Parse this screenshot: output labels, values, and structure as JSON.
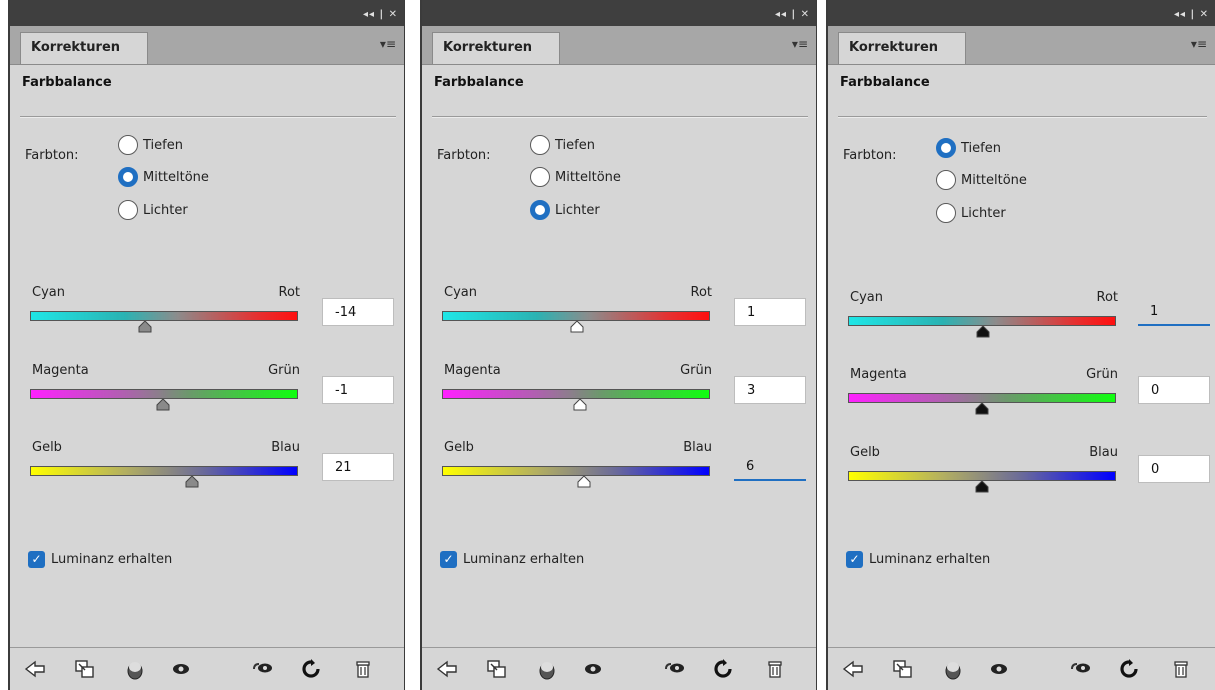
{
  "window": {
    "controls": "◂◂ | ✕"
  },
  "panels": [
    {
      "tab_label": "Korrekturen",
      "menu_icon": "▾≡",
      "title": "Farbbalance",
      "tone_label": "Farbton:",
      "tones": [
        {
          "label": "Tiefen",
          "checked": false
        },
        {
          "label": "Mitteltöne",
          "checked": true
        },
        {
          "label": "Lichter",
          "checked": false
        }
      ],
      "sliders": [
        {
          "left": "Cyan",
          "right": "Rot",
          "value": "-14",
          "min": -100,
          "max": 100,
          "thumb_color": "gray"
        },
        {
          "left": "Magenta",
          "right": "Grün",
          "value": "-1",
          "min": -100,
          "max": 100,
          "thumb_color": "gray"
        },
        {
          "left": "Gelb",
          "right": "Blau",
          "value": "21",
          "min": -100,
          "max": 100,
          "thumb_color": "gray"
        }
      ],
      "luminance_label": "Luminanz erhalten",
      "luminance_checked": true
    },
    {
      "tab_label": "Korrekturen",
      "menu_icon": "▾≡",
      "title": "Farbbalance",
      "tone_label": "Farbton:",
      "tones": [
        {
          "label": "Tiefen",
          "checked": false
        },
        {
          "label": "Mitteltöne",
          "checked": false
        },
        {
          "label": "Lichter",
          "checked": true
        }
      ],
      "sliders": [
        {
          "left": "Cyan",
          "right": "Rot",
          "value": "1",
          "min": -100,
          "max": 100,
          "thumb_color": "white"
        },
        {
          "left": "Magenta",
          "right": "Grün",
          "value": "3",
          "min": -100,
          "max": 100,
          "thumb_color": "white"
        },
        {
          "left": "Gelb",
          "right": "Blau",
          "value": "6",
          "min": -100,
          "max": 100,
          "thumb_color": "white"
        }
      ],
      "luminance_label": "Luminanz erhalten",
      "luminance_checked": true
    },
    {
      "tab_label": "Korrekturen",
      "menu_icon": "▾≡",
      "title": "Farbbalance",
      "tone_label": "Farbton:",
      "tones": [
        {
          "label": "Tiefen",
          "checked": true
        },
        {
          "label": "Mitteltöne",
          "checked": false
        },
        {
          "label": "Lichter",
          "checked": false
        }
      ],
      "sliders": [
        {
          "left": "Cyan",
          "right": "Rot",
          "value": "1",
          "min": -100,
          "max": 100,
          "thumb_color": "black"
        },
        {
          "left": "Magenta",
          "right": "Grün",
          "value": "0",
          "min": -100,
          "max": 100,
          "thumb_color": "black"
        },
        {
          "left": "Gelb",
          "right": "Blau",
          "value": "0",
          "min": -100,
          "max": 100,
          "thumb_color": "black"
        }
      ],
      "luminance_label": "Luminanz erhalten",
      "luminance_checked": true
    }
  ],
  "bottom_icons": [
    "back-arrow-icon",
    "clip-to-layer-icon",
    "visibility-toggle-icon",
    "eye-icon",
    "view-previous-icon",
    "reset-icon",
    "trash-icon"
  ],
  "colors": {
    "panel_bg": "#d6d6d6",
    "titlebar_bg": "#3f3f3f",
    "tabstrip_bg": "#a7a7a7",
    "accent": "#1f6fc2"
  }
}
